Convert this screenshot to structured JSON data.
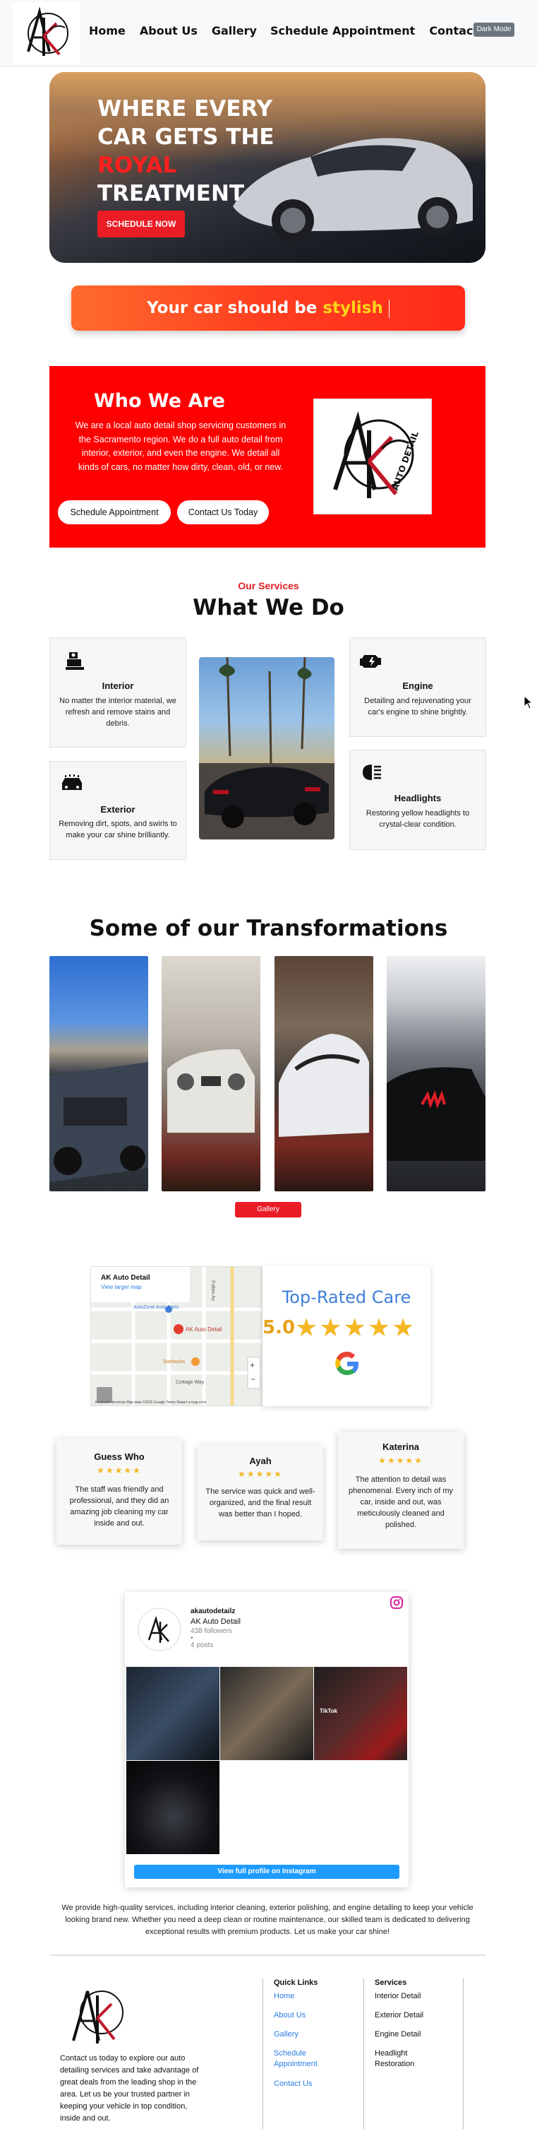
{
  "nav": {
    "links": [
      "Home",
      "About Us",
      "Gallery",
      "Schedule Appointment",
      "Contact Us"
    ],
    "dark_mode": "Dark Mode"
  },
  "hero": {
    "line1": "WHERE EVERY",
    "line2": "CAR GETS THE",
    "line3": "ROYAL",
    "line4": "TREATMENT",
    "cta": "SCHEDULE NOW"
  },
  "banner": {
    "prefix": "Your car should be ",
    "highlight": "stylish"
  },
  "who": {
    "title": "Who We Are",
    "text": "We are a local auto detail shop servicing customers in the Sacramento region. We do a full auto detail from interior, exterior, and even the engine. We detail all kinds of cars, no matter how dirty, clean, old, or new.",
    "btn_schedule": "Schedule Appointment",
    "btn_contact": "Contact Us Today",
    "logo_text": "AUTO DETAIL"
  },
  "services": {
    "kicker": "Our Services",
    "title": "What We Do",
    "items": [
      {
        "title": "Interior",
        "text": "No matter the interior material, we refresh and remove stains and debris.",
        "icon": "car-seat-icon"
      },
      {
        "title": "Engine",
        "text": "Detailing and rejuvenating your car's engine to shine brightly.",
        "icon": "engine-icon"
      },
      {
        "title": "Exterior",
        "text": "Removing dirt, spots, and swirls to make your car shine brilliantly.",
        "icon": "car-wash-icon"
      },
      {
        "title": "Headlights",
        "text": "Restoring yellow headlights to crystal-clear condition.",
        "icon": "headlight-icon"
      }
    ]
  },
  "transformations": {
    "title": "Some of our Transformations",
    "gallery_btn": "Gallery"
  },
  "map": {
    "place": "AK Auto Detail",
    "view_larger": "View larger map",
    "pin_label": "AK Auto Detail",
    "labels": [
      "AutoZone Auto Parts",
      "Starbucks",
      "Cottage Way",
      "Fulton Av"
    ],
    "attrib": "Keyboard shortcuts   Map data ©2025 Google   Terms   Report a map error"
  },
  "rating": {
    "title": "Top-Rated Care",
    "score": "5.0",
    "stars": "★★★★★"
  },
  "reviews": [
    {
      "name": "Guess Who",
      "stars": "★★★★★",
      "text": "The staff was friendly and professional, and they did an amazing job cleaning my car inside and out."
    },
    {
      "name": "Ayah",
      "stars": "★★★★★",
      "text": "The service was quick and well-organized, and the final result was better than I hoped."
    },
    {
      "name": "Katerina",
      "stars": "★★★★★",
      "text": "The attention to detail was phenomenal. Every inch of my car, inside and out, was meticulously cleaned and polished."
    }
  ],
  "instagram": {
    "handle": "akautodetailz",
    "name": "AK Auto Detail",
    "followers": "438 followers",
    "dot": "•",
    "posts": "4 posts",
    "tiktok_tag": "TikTok",
    "follow_btn": "View full profile on Instagram"
  },
  "blurb": "We provide high-quality services, including interior cleaning, exterior polishing, and engine detailing to keep your vehicle looking brand new. Whether you need a deep clean or routine maintenance, our skilled team is dedicated to delivering exceptional results with premium products. Let us make your car shine!",
  "footer": {
    "about": "Contact us today to explore our auto detailing services and take advantage of great deals from the leading shop in the area. Let us be your trusted partner in keeping your vehicle in top condition, inside and out.",
    "quick_links_title": "Quick Links",
    "quick_links": [
      "Home",
      "About Us",
      "Gallery",
      "Schedule Appointment",
      "Contact Us"
    ],
    "services_title": "Services",
    "services": [
      "Interior Detail",
      "Exterior Detail",
      "Engine Detail",
      "Headlight Restoration"
    ]
  },
  "colors": {
    "brand_red": "#ea1c26",
    "accent_yellow": "#ffd51a",
    "star": "#f5b724",
    "link_blue": "#2a7be4"
  }
}
